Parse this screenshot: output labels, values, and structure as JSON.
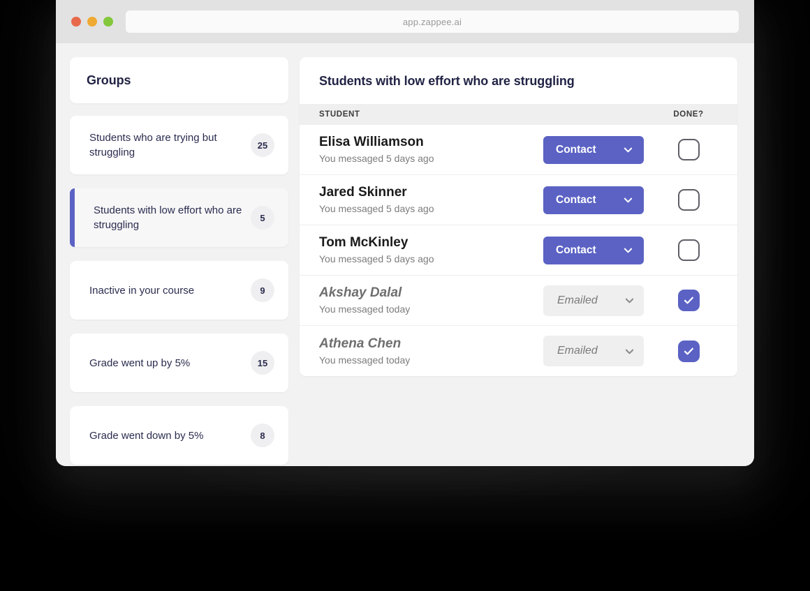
{
  "browser": {
    "url": "app.zappee.ai",
    "traffic_lights": [
      "close-red",
      "minimize-yellow",
      "maximize-green"
    ],
    "colors": {
      "red": "#e8694a",
      "yellow": "#eeaa33",
      "green": "#83c73a"
    }
  },
  "theme": {
    "accent": "#5b62c4",
    "app_background": "#f2f2f3",
    "card_background": "#ffffff",
    "table_header_background": "#efefef",
    "title_text": "#222445"
  },
  "sidebar": {
    "title": "Groups",
    "items": [
      {
        "label": "Students who are trying but struggling",
        "count": "25",
        "selected": false
      },
      {
        "label": "Students with low effort who are struggling",
        "count": "5",
        "selected": true
      },
      {
        "label": "Inactive in your course",
        "count": "9",
        "selected": false
      },
      {
        "label": "Grade went up by 5%",
        "count": "15",
        "selected": false
      },
      {
        "label": "Grade went down by 5%",
        "count": "8",
        "selected": false
      }
    ]
  },
  "main": {
    "title": "Students with low effort who are struggling",
    "columns": {
      "student": "STUDENT",
      "done": "DONE?"
    },
    "rows": [
      {
        "name": "Elisa Williamson",
        "status": "You messaged 5 days ago",
        "action_label": "Contact",
        "action_type": "contact",
        "done": false
      },
      {
        "name": "Jared Skinner",
        "status": "You messaged 5 days ago",
        "action_label": "Contact",
        "action_type": "contact",
        "done": false
      },
      {
        "name": "Tom McKinley",
        "status": "You messaged 5 days ago",
        "action_label": "Contact",
        "action_type": "contact",
        "done": false
      },
      {
        "name": "Akshay Dalal",
        "status": "You messaged today",
        "action_label": "Emailed",
        "action_type": "emailed",
        "done": true
      },
      {
        "name": "Athena Chen",
        "status": "You messaged today",
        "action_label": "Emailed",
        "action_type": "emailed",
        "done": true
      }
    ]
  }
}
